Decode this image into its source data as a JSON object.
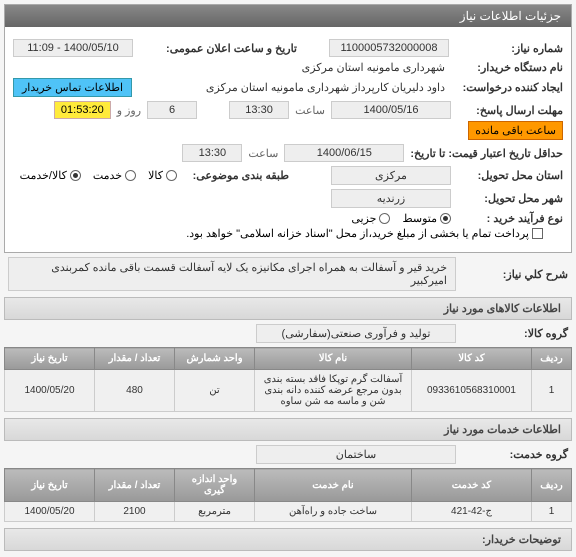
{
  "panel": {
    "title": "جزئیات اطلاعات نیاز"
  },
  "fields": {
    "need_no": {
      "label": "شماره نیاز:",
      "value": "1100005732000008"
    },
    "public_announce": {
      "label": "تاریخ و ساعت اعلان عمومی:",
      "value": "1400/05/10 - 11:09"
    },
    "buyer_org": {
      "label": "نام دستگاه خریدار:",
      "text": "شهرداری مامونیه استان مرکزی"
    },
    "requester": {
      "label": "ایجاد کننده درخواست:",
      "text": "داود  دلیریان   کارپرداز   شهرداری مامونیه استان مرکزی"
    },
    "buyer_contact": {
      "button": "اطلاعات تماس خریدار"
    },
    "response_deadline": {
      "label": "مهلت ارسال پاسخ:",
      "date": "1400/05/16",
      "hour_label": "ساعت",
      "hour": "13:30",
      "day_label": "روز و",
      "day": "6",
      "remain": "01:53:20",
      "remain_label": "ساعت باقی مانده"
    },
    "validity": {
      "label": "حداقل تاریخ اعتبار قیمت: تا تاریخ:",
      "date": "1400/06/15",
      "hour_label": "ساعت",
      "hour": "13:30"
    },
    "delivery_province": {
      "label": "استان محل تحویل:",
      "value": "مرکزی"
    },
    "delivery_city": {
      "label": "شهر محل تحویل:",
      "value": "زرندیه"
    },
    "category": {
      "label": "طبقه بندی موضوعی:"
    },
    "category_options": {
      "goods": "کالا",
      "service": "خدمت",
      "both": "کالا/خدمت"
    },
    "buy_process": {
      "label": "نوع فرآیند خرید :"
    },
    "buy_options": {
      "medium": "متوسط",
      "minor": "جزیی"
    },
    "payment_note": "پرداخت تمام یا بخشی از مبلغ خرید،از محل \"اسناد خزانه اسلامی\" خواهد بود."
  },
  "need_title": {
    "label": "شرح کلي نياز:",
    "text": "خرید قیر و آسفالت به همراه اجرای مکانیزه یک لایه آسفالت قسمت باقی مانده کمربندی امیرکبیر"
  },
  "goods_section": {
    "title": "اطلاعات کالاهای مورد نیاز"
  },
  "goods_group": {
    "label": "گروه کالا:",
    "value": "تولید و فرآوری صنعتی(سفارشی)"
  },
  "goods_table": {
    "headers": {
      "row": "ردیف",
      "code": "کد کالا",
      "name": "نام کالا",
      "unit": "واحد شمارش",
      "qty": "تعداد / مقدار",
      "need_date": "تاریخ نیاز"
    },
    "rows": [
      {
        "row": "1",
        "code": "0933610568310001",
        "name": "آسفالت گرم توپکا فاقد بسته بندی بدون مرجع عرضه کننده دانه بندی شن و ماسه مه شن ساوه",
        "unit": "تن",
        "qty": "480",
        "need_date": "1400/05/20"
      }
    ]
  },
  "services_section": {
    "title": "اطلاعات خدمات مورد نیاز"
  },
  "services_group": {
    "label": "گروه خدمت:",
    "value": "ساختمان"
  },
  "services_table": {
    "headers": {
      "row": "ردیف",
      "code": "کد خدمت",
      "name": "نام خدمت",
      "unit": "واحد اندازه گیری",
      "qty": "تعداد / مقدار",
      "need_date": "تاریخ نیاز"
    },
    "rows": [
      {
        "row": "1",
        "code": "ج-42-421",
        "name": "ساخت جاده و راه‌آهن",
        "unit": "مترمربع",
        "qty": "2100",
        "need_date": "1400/05/20"
      }
    ]
  },
  "buyer_notes": {
    "title": "توضیحات خریدار:"
  }
}
